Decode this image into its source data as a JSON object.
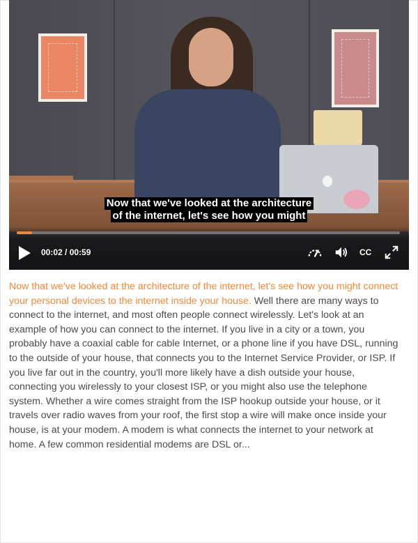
{
  "video": {
    "caption_line1": "Now that we've looked at the architecture",
    "caption_line2": "of the internet, let's see how you might",
    "time_display": "00:02 / 00:59",
    "progress_fraction": 0.04,
    "accent_color": "#f0883a",
    "controls": {
      "play_icon": "play-icon",
      "speed_icon": "speedometer-icon",
      "volume_icon": "volume-icon",
      "cc_label": "CC",
      "fullscreen_icon": "fullscreen-icon"
    }
  },
  "transcript": {
    "highlighted": "Now that we've looked at the architecture of the internet, let's see how you might connect your personal devices to the internet inside your house.",
    "rest": " Well there are many ways to connect to the internet, and most often people connect wirelessly. Let's look at an example of how you can connect to the internet. If you live in a city or a town, you probably have a coaxial cable for cable Internet, or a phone line if you have DSL, running to the outside of your house, that connects you to the Internet Service Provider, or ISP. If you live far out in the country, you'll more likely have a dish outside your house, connecting you wirelessly to your closest ISP, or you might also use the telephone system. Whether a wire comes straight from the ISP hookup outside your house, or it travels over radio waves from your roof, the first stop a wire will make once inside your house, is at your modem. A modem is what connects the internet to your network at home. A few common residential modems are DSL or..."
  }
}
